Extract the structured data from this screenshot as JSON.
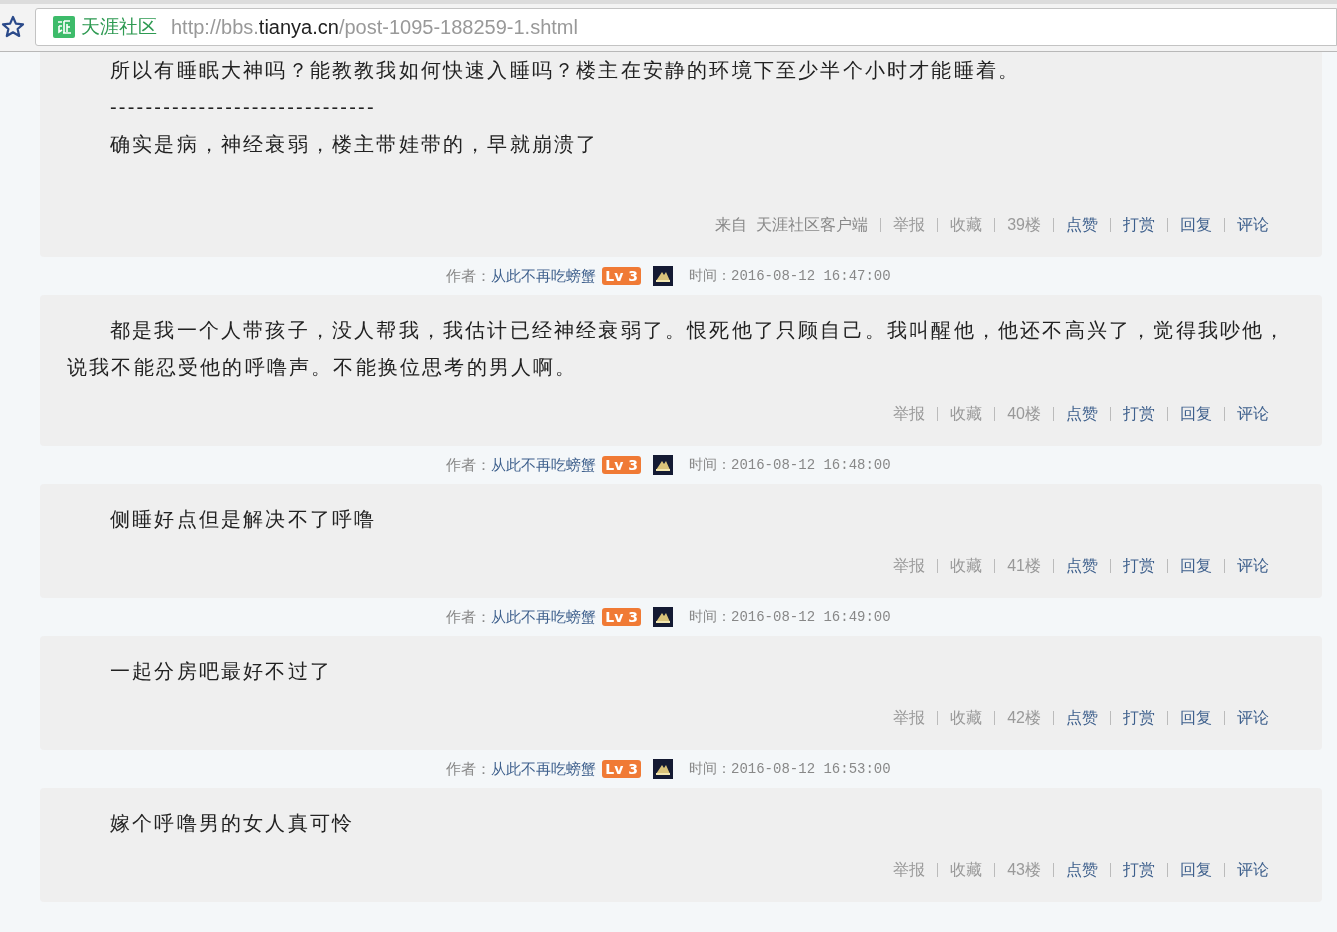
{
  "address_bar": {
    "site_name": "天涯社区",
    "url_scheme": "http://bbs.",
    "url_domain": "tianya.cn",
    "url_path": "/post-1095-188259-1.shtml"
  },
  "posts": [
    {
      "paragraphs": [
        "所以有睡眠大神吗？能教教我如何快速入睡吗？楼主在安静的环境下至少半个小时才能睡着。",
        "------------------------------",
        "确实是病，神经衰弱，楼主带娃带的，早就崩溃了"
      ],
      "source": "来自  天涯社区客户端",
      "actions": [
        {
          "label": "举报",
          "kind": "plain"
        },
        {
          "label": "收藏",
          "kind": "plain"
        },
        {
          "label": "39楼",
          "kind": "plain"
        },
        {
          "label": "点赞",
          "kind": "link"
        },
        {
          "label": "打赏",
          "kind": "link"
        },
        {
          "label": "回复",
          "kind": "link"
        },
        {
          "label": "评论",
          "kind": "link"
        }
      ]
    },
    {
      "header": {
        "author_label": "作者：",
        "author": "从此不再吃螃蟹",
        "level": "Lv 3",
        "time": "时间：2016-08-12 16:47:00"
      },
      "paragraphs": [
        "都是我一个人带孩子，没人帮我，我估计已经神经衰弱了。恨死他了只顾自己。我叫醒他，他还不高兴了，觉得我吵他，说我不能忍受他的呼噜声。不能换位思考的男人啊。"
      ],
      "actions": [
        {
          "label": "举报",
          "kind": "plain"
        },
        {
          "label": "收藏",
          "kind": "plain"
        },
        {
          "label": "40楼",
          "kind": "plain"
        },
        {
          "label": "点赞",
          "kind": "link"
        },
        {
          "label": "打赏",
          "kind": "link"
        },
        {
          "label": "回复",
          "kind": "link"
        },
        {
          "label": "评论",
          "kind": "link"
        }
      ]
    },
    {
      "header": {
        "author_label": "作者：",
        "author": "从此不再吃螃蟹",
        "level": "Lv 3",
        "time": "时间：2016-08-12 16:48:00"
      },
      "paragraphs": [
        "侧睡好点但是解决不了呼噜"
      ],
      "actions": [
        {
          "label": "举报",
          "kind": "plain"
        },
        {
          "label": "收藏",
          "kind": "plain"
        },
        {
          "label": "41楼",
          "kind": "plain"
        },
        {
          "label": "点赞",
          "kind": "link"
        },
        {
          "label": "打赏",
          "kind": "link"
        },
        {
          "label": "回复",
          "kind": "link"
        },
        {
          "label": "评论",
          "kind": "link"
        }
      ]
    },
    {
      "header": {
        "author_label": "作者：",
        "author": "从此不再吃螃蟹",
        "level": "Lv 3",
        "time": "时间：2016-08-12 16:49:00"
      },
      "paragraphs": [
        "一起分房吧最好不过了"
      ],
      "actions": [
        {
          "label": "举报",
          "kind": "plain"
        },
        {
          "label": "收藏",
          "kind": "plain"
        },
        {
          "label": "42楼",
          "kind": "plain"
        },
        {
          "label": "点赞",
          "kind": "link"
        },
        {
          "label": "打赏",
          "kind": "link"
        },
        {
          "label": "回复",
          "kind": "link"
        },
        {
          "label": "评论",
          "kind": "link"
        }
      ]
    },
    {
      "header": {
        "author_label": "作者：",
        "author": "从此不再吃螃蟹",
        "level": "Lv 3",
        "time": "时间：2016-08-12 16:53:00"
      },
      "paragraphs": [
        "嫁个呼噜男的女人真可怜"
      ],
      "actions": [
        {
          "label": "举报",
          "kind": "plain"
        },
        {
          "label": "收藏",
          "kind": "plain"
        },
        {
          "label": "43楼",
          "kind": "plain"
        },
        {
          "label": "点赞",
          "kind": "link"
        },
        {
          "label": "打赏",
          "kind": "link"
        },
        {
          "label": "回复",
          "kind": "link"
        },
        {
          "label": "评论",
          "kind": "link"
        }
      ]
    }
  ]
}
